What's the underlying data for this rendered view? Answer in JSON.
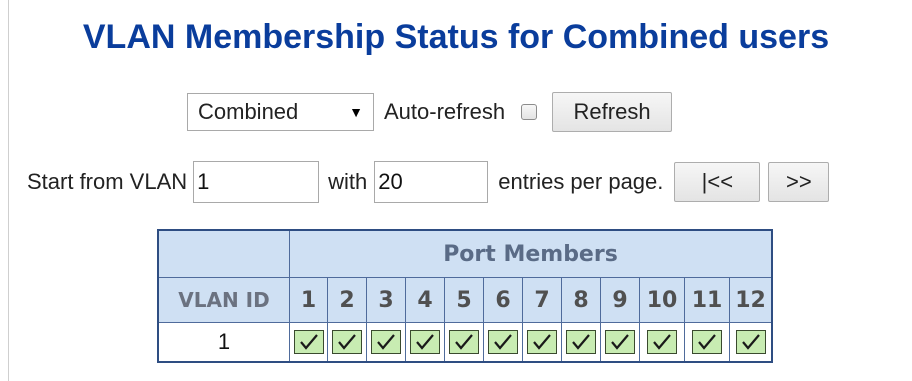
{
  "page": {
    "title": "VLAN Membership Status for Combined users"
  },
  "controls": {
    "user_select_value": "Combined",
    "auto_refresh_label": "Auto-refresh",
    "auto_refresh_checked": false,
    "refresh_label": "Refresh"
  },
  "paging": {
    "start_label": "Start from VLAN",
    "start_value": "1",
    "with_label": "with",
    "entries_value": "20",
    "entries_label": "entries per page.",
    "first_label": "|<<",
    "next_label": ">>"
  },
  "table": {
    "port_members_header": "Port Members",
    "vlan_id_header": "VLAN ID",
    "ports": [
      "1",
      "2",
      "3",
      "4",
      "5",
      "6",
      "7",
      "8",
      "9",
      "10",
      "11",
      "12"
    ],
    "rows": [
      {
        "vlan_id": "1",
        "members": [
          true,
          true,
          true,
          true,
          true,
          true,
          true,
          true,
          true,
          true,
          true,
          true
        ]
      }
    ]
  },
  "colors": {
    "title": "#0a3d9c",
    "header_bg": "#cfe0f3",
    "check_bg": "#c8ecb2"
  }
}
